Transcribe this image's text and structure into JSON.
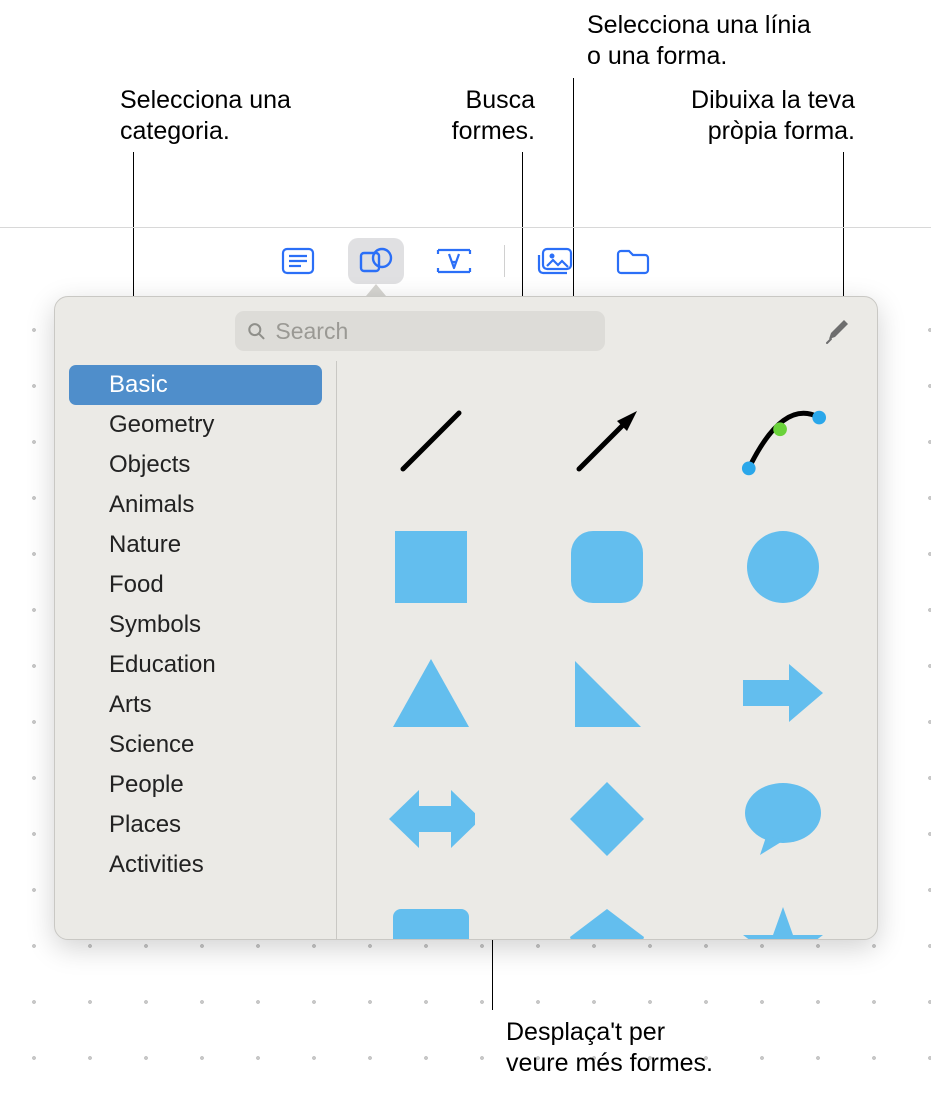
{
  "callouts": {
    "select_category": "Selecciona una\ncategoria.",
    "search_shapes": "Busca\nformes.",
    "select_line_or_shape": "Selecciona una línia\no una forma.",
    "draw_own_shape": "Dibuixa la teva\npròpia forma.",
    "scroll_more": "Desplaça't per\nveure més formes."
  },
  "toolbar": {
    "items": [
      {
        "name": "text-block-icon",
        "active": false
      },
      {
        "name": "shapes-icon",
        "active": true
      },
      {
        "name": "text-box-icon",
        "active": false
      },
      {
        "name": "media-icon",
        "active": false
      },
      {
        "name": "folder-icon",
        "active": false
      }
    ]
  },
  "search": {
    "placeholder": "Search",
    "value": ""
  },
  "categories": [
    {
      "label": "Basic",
      "selected": true
    },
    {
      "label": "Geometry",
      "selected": false
    },
    {
      "label": "Objects",
      "selected": false
    },
    {
      "label": "Animals",
      "selected": false
    },
    {
      "label": "Nature",
      "selected": false
    },
    {
      "label": "Food",
      "selected": false
    },
    {
      "label": "Symbols",
      "selected": false
    },
    {
      "label": "Education",
      "selected": false
    },
    {
      "label": "Arts",
      "selected": false
    },
    {
      "label": "Science",
      "selected": false
    },
    {
      "label": "People",
      "selected": false
    },
    {
      "label": "Places",
      "selected": false
    },
    {
      "label": "Activities",
      "selected": false
    }
  ],
  "shapes": [
    {
      "name": "line-shape"
    },
    {
      "name": "arrow-line-shape"
    },
    {
      "name": "curve-editable-shape"
    },
    {
      "name": "square-shape"
    },
    {
      "name": "rounded-square-shape"
    },
    {
      "name": "circle-shape"
    },
    {
      "name": "triangle-shape"
    },
    {
      "name": "right-triangle-shape"
    },
    {
      "name": "arrow-right-shape"
    },
    {
      "name": "arrow-left-right-shape"
    },
    {
      "name": "diamond-shape"
    },
    {
      "name": "speech-bubble-shape"
    },
    {
      "name": "callout-rect-shape"
    },
    {
      "name": "pentagon-shape"
    },
    {
      "name": "star-shape"
    }
  ],
  "colors": {
    "shape_fill": "#63beee",
    "selection": "#4f8ecb"
  }
}
